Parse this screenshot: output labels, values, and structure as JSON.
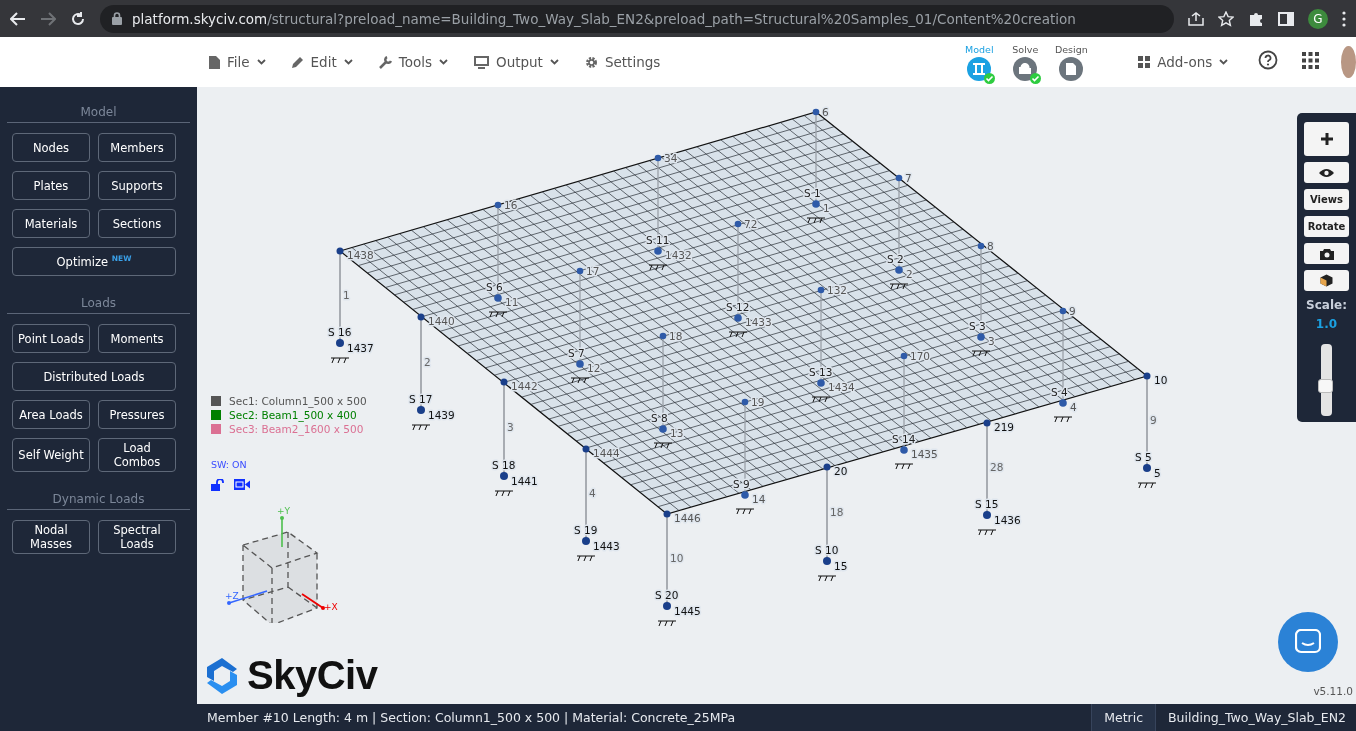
{
  "browser": {
    "url_host": "platform.skyciv.com",
    "url_path": "/structural?preload_name=Building_Two_Way_Slab_EN2&preload_path=Structural%20Samples_01/Content%20creation",
    "profile_initial": "G"
  },
  "menu": [
    {
      "label": "File",
      "kind": "file",
      "dropdown": true
    },
    {
      "label": "Edit",
      "kind": "edit",
      "dropdown": true
    },
    {
      "label": "Tools",
      "kind": "tools",
      "dropdown": true
    },
    {
      "label": "Output",
      "kind": "output",
      "dropdown": true
    },
    {
      "label": "Settings",
      "kind": "settings",
      "dropdown": false
    }
  ],
  "stepper": [
    {
      "label": "Model",
      "selected": true,
      "done": true,
      "kind": "model"
    },
    {
      "label": "Solve",
      "selected": false,
      "done": true,
      "kind": "solve"
    },
    {
      "label": "Design",
      "selected": false,
      "done": false,
      "kind": "design"
    }
  ],
  "addons": {
    "label": "Add-ons"
  },
  "sidebar": {
    "sections": [
      {
        "title": "Model",
        "buttons": [
          {
            "label": "Nodes",
            "kind": "half"
          },
          {
            "label": "Members",
            "kind": "half"
          },
          {
            "label": "Plates",
            "kind": "half"
          },
          {
            "label": "Supports",
            "kind": "half"
          },
          {
            "label": "Materials",
            "kind": "half"
          },
          {
            "label": "Sections",
            "kind": "half"
          },
          {
            "label": "Optimize",
            "badge": "NEW",
            "kind": "wide"
          }
        ]
      },
      {
        "title": "Loads",
        "buttons": [
          {
            "label": "Point Loads",
            "kind": "half"
          },
          {
            "label": "Moments",
            "kind": "half"
          },
          {
            "label": "Distributed Loads",
            "kind": "wide"
          },
          {
            "label": "Area Loads",
            "kind": "half"
          },
          {
            "label": "Pressures",
            "kind": "half"
          },
          {
            "label": "Self Weight",
            "kind": "half"
          },
          {
            "label": "Load Combos",
            "kind": "half"
          }
        ]
      },
      {
        "title": "Dynamic Loads",
        "buttons": [
          {
            "label": "Nodal Masses",
            "kind": "half"
          },
          {
            "label": "Spectral Loads",
            "kind": "half"
          }
        ]
      }
    ]
  },
  "legend": [
    {
      "label": "Sec1: Column1_500 x 500",
      "color": "#555555"
    },
    {
      "label": "Sec2: Beam1_500 x 400",
      "color": "#008000"
    },
    {
      "label": "Sec3: Beam2_1600 x 500",
      "color": "#db7093"
    }
  ],
  "self_weight": "SW: ON",
  "axes": {
    "y": "+Y",
    "z": "+Z",
    "x": "+X"
  },
  "model": {
    "columns": [
      {
        "top_node": "1438",
        "member": "1",
        "support": "S 16",
        "base_node": "1437"
      },
      {
        "top_node": "1440",
        "member": "2",
        "support": "S 17",
        "base_node": "1439"
      },
      {
        "top_node": "1442",
        "member": "3",
        "support": "S 18",
        "base_node": "1441"
      },
      {
        "top_node": "1444",
        "member": "4",
        "support": "S 19",
        "base_node": "1443"
      },
      {
        "top_node": "1446",
        "member": "10",
        "support": "S 20",
        "base_node": "1445"
      },
      {
        "top_node": "20",
        "member": "18",
        "support": "S 10",
        "base_node": "15"
      },
      {
        "top_node": "219",
        "member": "28",
        "support": "S 15",
        "base_node": "1436"
      },
      {
        "top_node": "10",
        "member": "9",
        "support": "S 5",
        "base_node": "5"
      }
    ],
    "interior": [
      {
        "top_node": "16",
        "support": "S 6",
        "base_node": "11"
      },
      {
        "top_node": "34",
        "support": "S 11",
        "base_node": "1432"
      },
      {
        "top_node": "6",
        "support": "S 1",
        "base_node": "1"
      },
      {
        "top_node": "17",
        "support": "S 7",
        "base_node": "12"
      },
      {
        "top_node": "72",
        "support": "S 12",
        "base_node": "1433"
      },
      {
        "top_node": "7",
        "support": "S 2",
        "base_node": "2"
      },
      {
        "top_node": "18",
        "support": "S 8",
        "base_node": "13"
      },
      {
        "top_node": "132",
        "support": "S 13",
        "base_node": "1434"
      },
      {
        "top_node": "8",
        "support": "S 3",
        "base_node": "3"
      },
      {
        "top_node": "19",
        "support": "S 9",
        "base_node": "14"
      },
      {
        "top_node": "170",
        "support": "S 14",
        "base_node": "1435"
      },
      {
        "top_node": "9",
        "support": "S 4",
        "base_node": "4"
      }
    ]
  },
  "toolbar": {
    "buttons": [
      {
        "kind": "plus"
      },
      {
        "kind": "eye"
      },
      {
        "kind": "text",
        "label": "Views"
      },
      {
        "kind": "text",
        "label": "Rotate"
      },
      {
        "kind": "camera"
      },
      {
        "kind": "cube"
      }
    ],
    "scale_label": "Scale:",
    "scale_value": "1.0",
    "scale_slider": {
      "level": 0.4
    }
  },
  "logo": "SkyCiv",
  "version": "v5.11.0",
  "status_bar": {
    "text": "Member #10 Length: 4 m | Section: Column1_500 x 500 | Material: Concrete_25MPa",
    "units": "Metric",
    "project": "Building_Two_Way_Slab_EN2"
  }
}
